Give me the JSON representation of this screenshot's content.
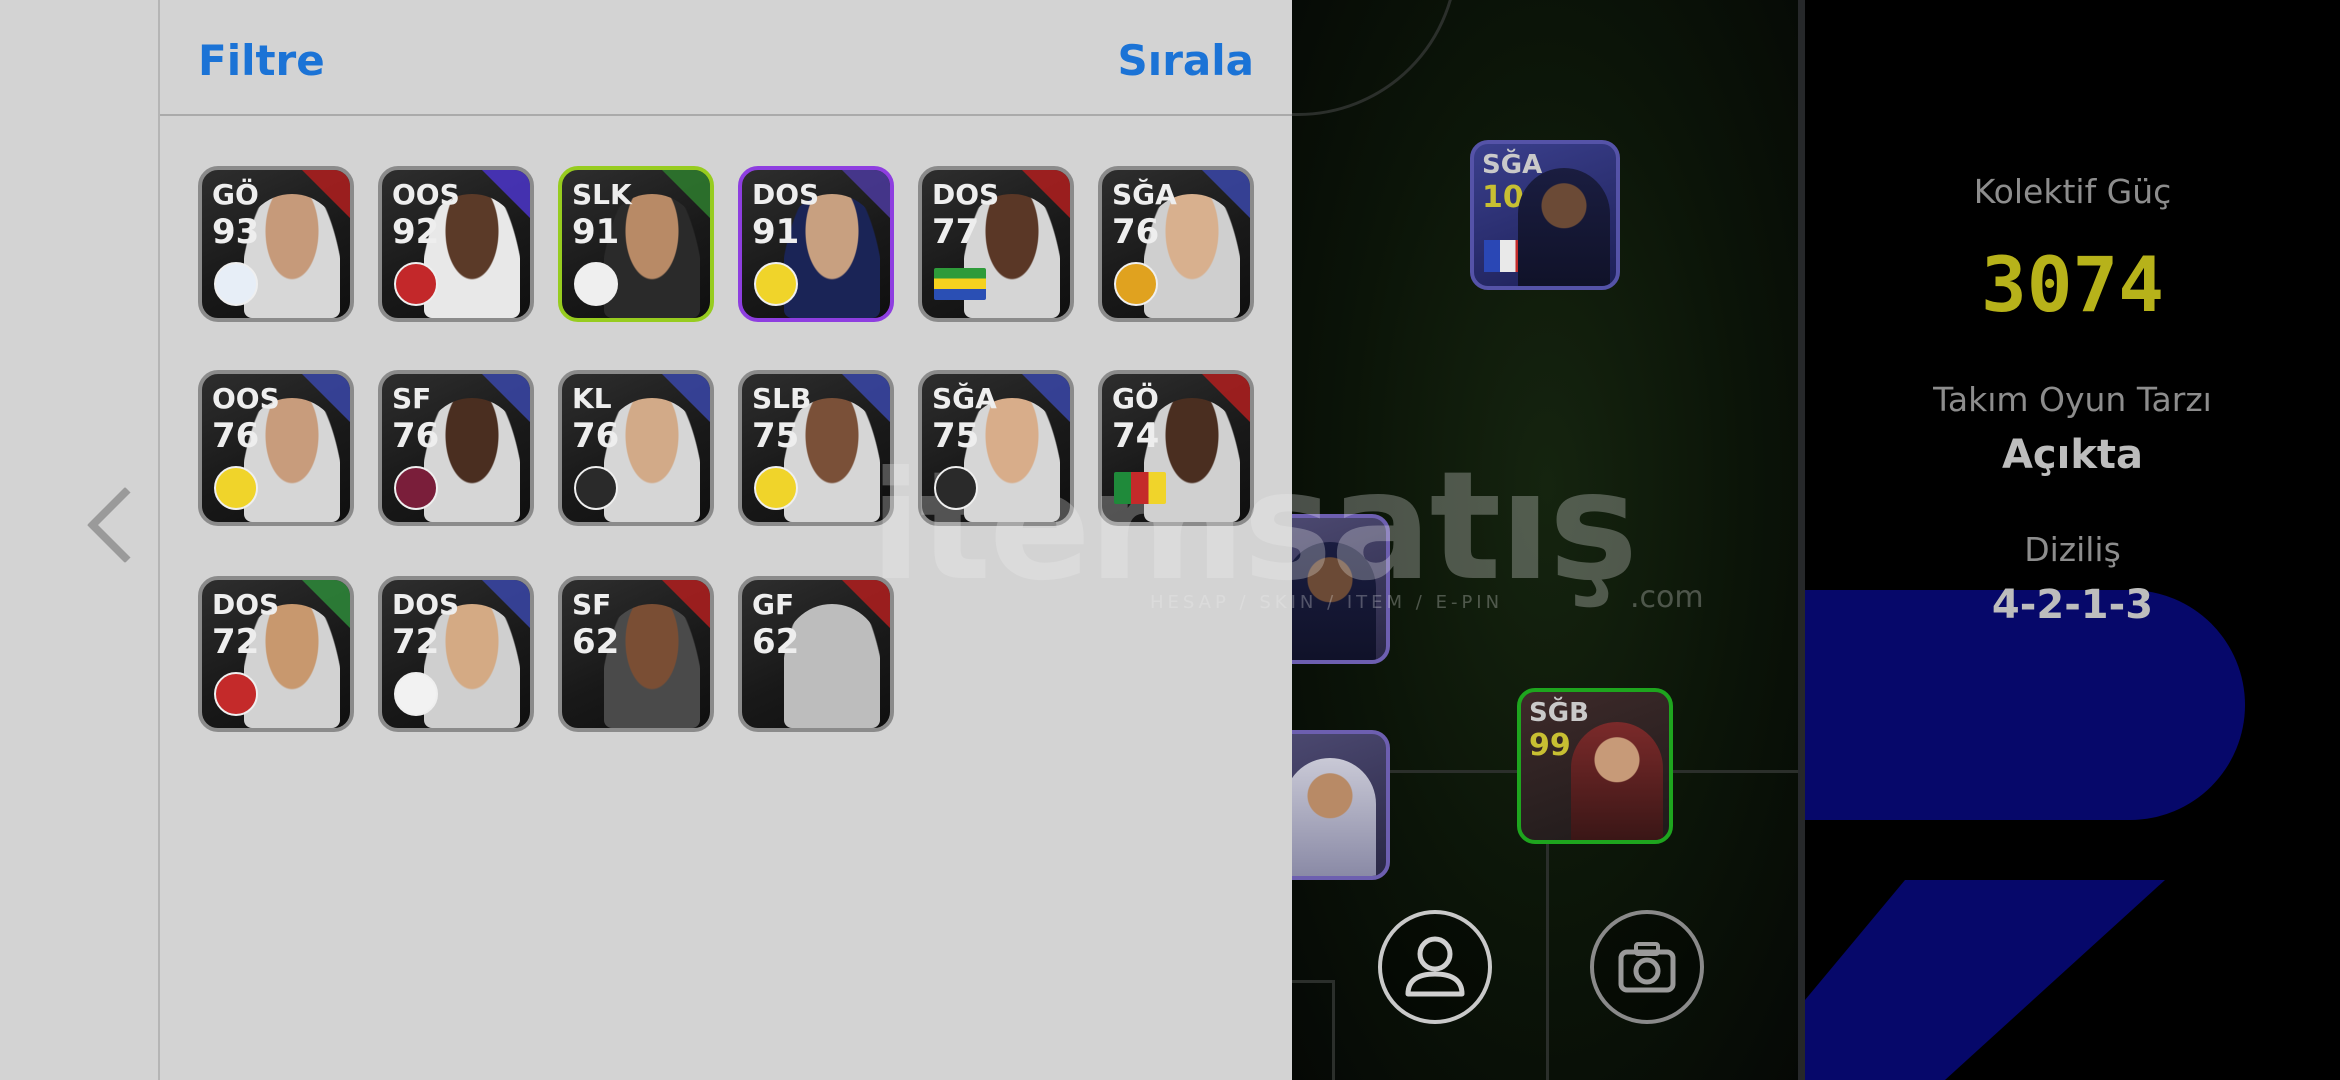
{
  "header": {
    "filter_label": "Filtre",
    "sort_label": "Sırala"
  },
  "cards": [
    {
      "position": "GÖ",
      "rating": "93"
    },
    {
      "position": "OOS",
      "rating": "92"
    },
    {
      "position": "SLK",
      "rating": "91"
    },
    {
      "position": "DOS",
      "rating": "91"
    },
    {
      "position": "DOS",
      "rating": "77"
    },
    {
      "position": "SĞA",
      "rating": "76"
    },
    {
      "position": "OOS",
      "rating": "76"
    },
    {
      "position": "SF",
      "rating": "76"
    },
    {
      "position": "KL",
      "rating": "76"
    },
    {
      "position": "SLB",
      "rating": "75"
    },
    {
      "position": "SĞA",
      "rating": "75"
    },
    {
      "position": "GÖ",
      "rating": "74"
    },
    {
      "position": "DOS",
      "rating": "72"
    },
    {
      "position": "DOS",
      "rating": "72"
    },
    {
      "position": "SF",
      "rating": "62"
    },
    {
      "position": "GF",
      "rating": "62"
    }
  ],
  "pitch": {
    "card_top": {
      "position": "SĞA",
      "rating": "100"
    },
    "card_green": {
      "position": "SĞB",
      "rating": "99"
    }
  },
  "stats": {
    "power_label": "Kolektif Güç",
    "power_value": "3074",
    "style_label": "Takım Oyun Tarzı",
    "style_value": "Açıkta",
    "formation_label": "Diziliş",
    "formation_value": "4-2-1-3"
  },
  "watermark": {
    "main": "itemsatış",
    "sub": "HESAP / SKIN / ITEM / E-PIN",
    "domain": ".com"
  },
  "colors": {
    "accent_blue": "#1b73d6",
    "power_yellow": "#b7b21a",
    "highlight_green": "#97cc1f",
    "highlight_purple": "#8e3ee0"
  },
  "icons": {
    "back": "chevron-left-icon",
    "profile": "person-icon",
    "camera": "camera-icon"
  }
}
